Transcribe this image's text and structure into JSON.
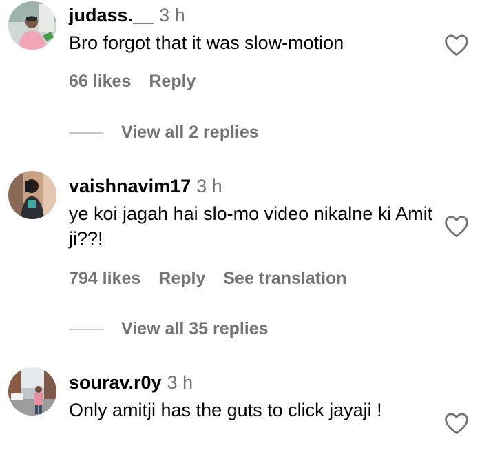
{
  "comments": [
    {
      "username": "judass.__",
      "time": "3 h",
      "text": "Bro forgot that it was slow-motion",
      "likes": "66 likes",
      "reply": "Reply",
      "view_replies": "View all 2 replies",
      "avatar_icon": "avatar-person-pink-shirt"
    },
    {
      "username": "vaishnavim17",
      "time": "3 h",
      "text": "ye koi jagah hai slo-mo video nikalne ki Amit ji??!",
      "likes": "794 likes",
      "reply": "Reply",
      "see_translation": "See translation",
      "view_replies": "View all 35 replies",
      "avatar_icon": "avatar-person-mirror-selfie"
    },
    {
      "username": "sourav.r0y",
      "time": "3 h",
      "text": "Only amitji has the guts to click jayaji !",
      "avatar_icon": "avatar-person-street"
    }
  ],
  "colors": {
    "primary_text": "#000000",
    "secondary_text": "#737373",
    "divider": "#c7c7c7",
    "background": "#ffffff"
  },
  "icons": {
    "like": "heart-outline-icon"
  }
}
